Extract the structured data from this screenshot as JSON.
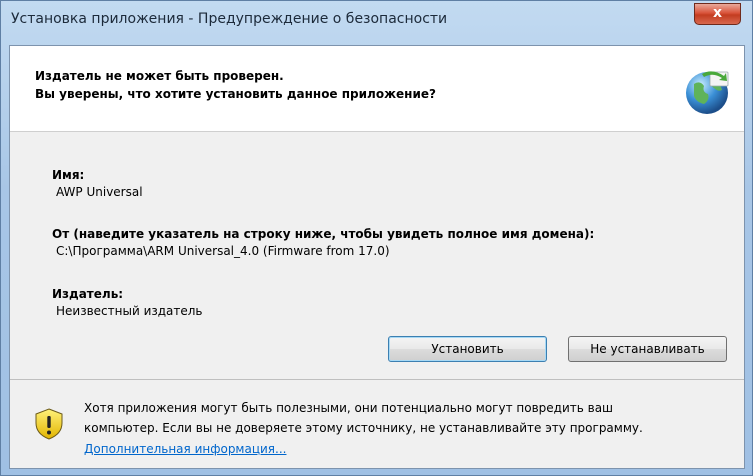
{
  "window": {
    "title": "Установка приложения - Предупреждение о безопасности",
    "close_label": "x"
  },
  "header": {
    "line1": "Издатель не может быть проверен.",
    "line2": "Вы уверены, что хотите установить данное приложение?"
  },
  "details": {
    "name_label": "Имя:",
    "name_value": "AWP Universal",
    "from_label": "От (наведите указатель на строку ниже, чтобы увидеть полное имя домена):",
    "from_value": "C:\\Программа\\ARM Universal_4.0  (Firmware from 17.0)",
    "publisher_label": "Издатель:",
    "publisher_value": "Неизвестный издатель"
  },
  "buttons": {
    "install": "Установить",
    "dont_install": "Не устанавливать"
  },
  "footer": {
    "warning_line1": "Хотя приложения могут быть полезными, они потенциально могут повредить ваш",
    "warning_line2": "компьютер. Если вы не доверяете этому источнику, не устанавливайте эту программу.",
    "more_info_link": "Дополнительная информация..."
  },
  "icons": {
    "header_icon": "globe-install-icon",
    "warning_icon": "shield-warning-icon"
  },
  "colors": {
    "link": "#0066cc",
    "close_button": "#d9543b",
    "title_gradient": "#a8c6e6"
  }
}
